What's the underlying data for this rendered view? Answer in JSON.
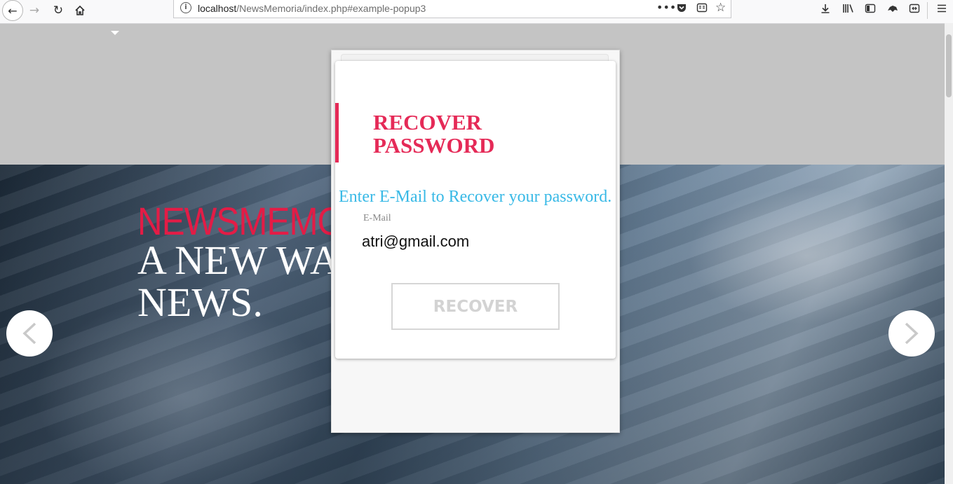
{
  "browser": {
    "url_host": "localhost",
    "url_path": "/NewsMemoria/index.php#example-popup3"
  },
  "hero": {
    "title": "NEWSMEMORIA",
    "subtitle_line1": "A NEW WAY TO LEARN",
    "subtitle_line2": "NEWS."
  },
  "popup": {
    "title": "RECOVER PASSWORD",
    "subtitle": "Enter E-Mail to Recover your password.",
    "email_label": "E-Mail",
    "email_value": "atri@gmail.com",
    "recover_label": "RECOVER"
  },
  "colors": {
    "accent_red": "#e52a57",
    "subtitle_blue": "#38b9e6",
    "hero_title_red": "#e31c46"
  }
}
